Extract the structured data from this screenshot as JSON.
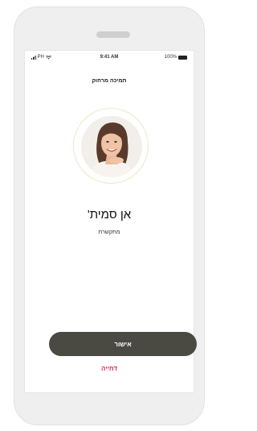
{
  "statusbar": {
    "carrier": "PH",
    "time": "9:41 AM",
    "battery": "100%"
  },
  "screen": {
    "title": "תמיכה מרחוק"
  },
  "caller": {
    "name": "אן סמית'",
    "status": "מתקשרת"
  },
  "actions": {
    "accept_label": "אישור",
    "decline_label": "דחייה"
  },
  "colors": {
    "accept_button": "#4a4a43",
    "decline_text": "#e0284a",
    "avatar_ring": "#ece9c8"
  }
}
